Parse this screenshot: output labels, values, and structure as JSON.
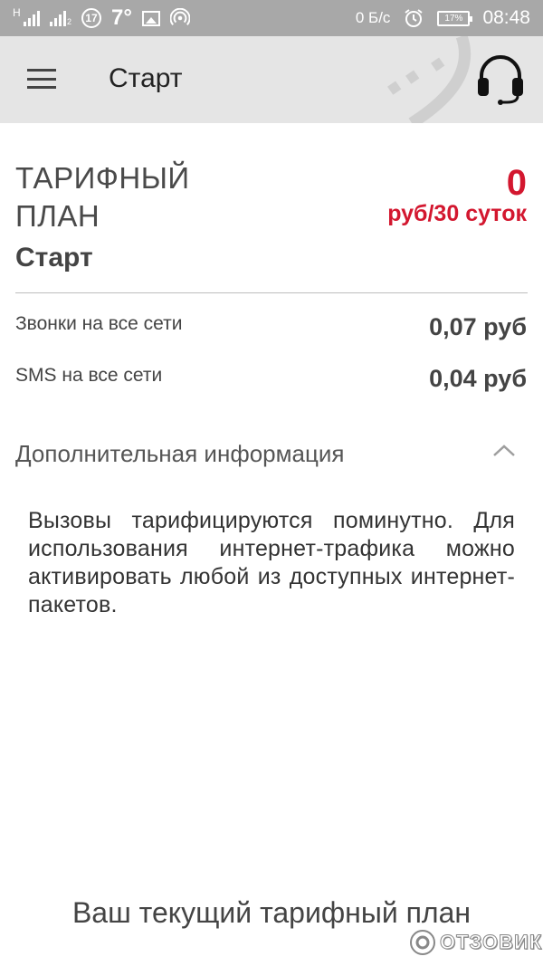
{
  "status_bar": {
    "network_letter": "H",
    "sim2_sub": "2",
    "notification_count": "17",
    "temperature": "7°",
    "data_speed": "0 Б/с",
    "battery_percent": "17%",
    "time": "08:48"
  },
  "app_bar": {
    "title": "Старт",
    "menu_icon": "hamburger-menu-icon",
    "support_icon": "headset-icon"
  },
  "tariff": {
    "label": "ТАРИФНЫЙ ПЛАН",
    "name": "Старт",
    "price_amount": "0",
    "price_period": "руб/30 суток",
    "accent_color": "#d3172f"
  },
  "rates": [
    {
      "label": "Звонки на все сети",
      "value": "0,07 руб"
    },
    {
      "label": "SMS на все сети",
      "value": "0,04 руб"
    }
  ],
  "additional_info": {
    "title": "Дополнительная информация",
    "expanded": true,
    "text": "Вызовы тарифицируются поминутно. Для использования интернет-трафика можно активировать любой из доступных интернет-пакетов."
  },
  "caption": "Ваш текущий тарифный план",
  "watermark": "ОТЗОВИК"
}
